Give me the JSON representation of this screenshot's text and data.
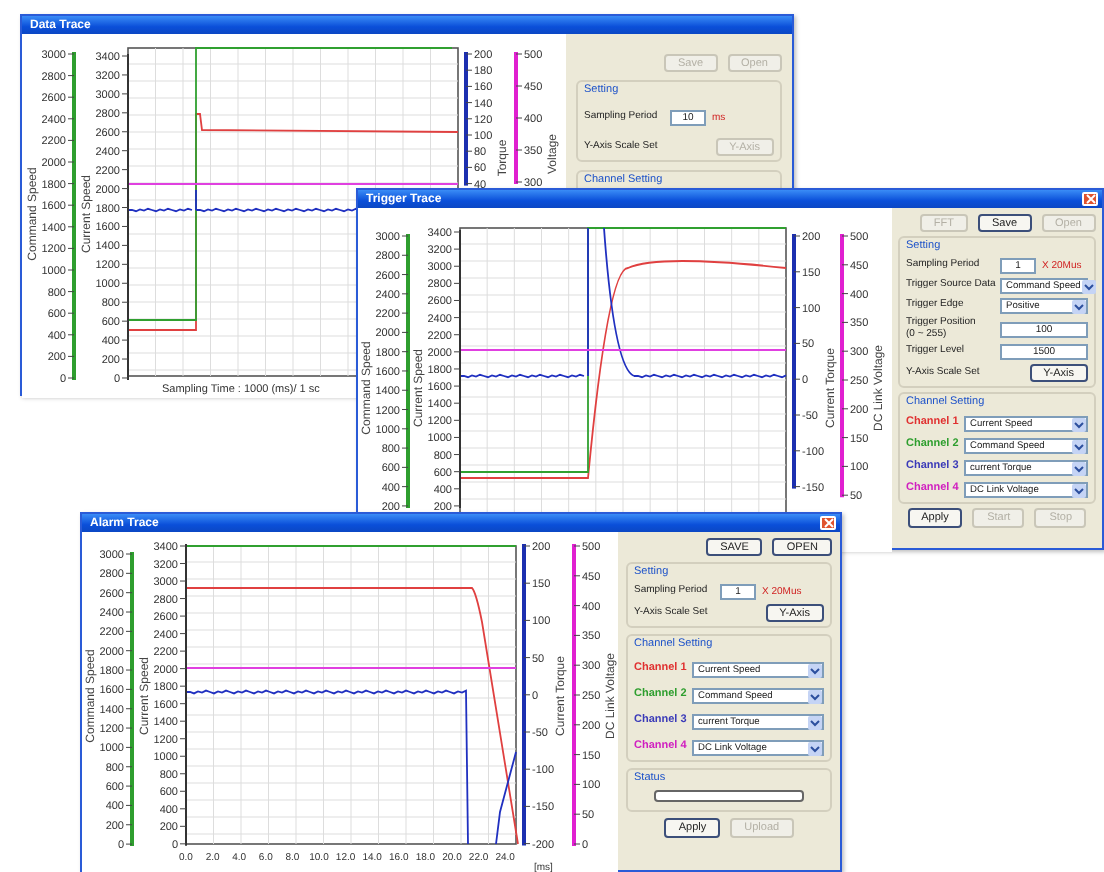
{
  "windows": [
    {
      "title": "Data Trace",
      "closable": false,
      "chart": {
        "left_axes": [
          {
            "title": "Command Speed",
            "color": "#2e9e2e",
            "ticks": [
              "3000",
              "2800",
              "2600",
              "2400",
              "2200",
              "2000",
              "1800",
              "1600",
              "1400",
              "1200",
              "1000",
              "800",
              "600",
              "400",
              "200",
              "0"
            ]
          },
          {
            "title": "Current Speed",
            "color": "#333333",
            "ticks": [
              "3400",
              "3200",
              "3000",
              "2800",
              "2600",
              "2400",
              "2200",
              "2000",
              "1800",
              "1600",
              "1400",
              "1200",
              "1000",
              "800",
              "600",
              "400",
              "200",
              "0"
            ]
          }
        ],
        "right_axes": [
          {
            "title": "Torque",
            "color": "#1c2fb0",
            "ticks": [
              "200",
              "180",
              "160",
              "140",
              "120",
              "100",
              "80",
              "60",
              "40"
            ]
          },
          {
            "title": "Voltage",
            "color": "#e020d0",
            "ticks": [
              "500",
              "450",
              "400",
              "350",
              "300"
            ]
          }
        ],
        "xlabel": "Sampling Time : 1000 (ms)/ 1 sc"
      },
      "panel": {
        "buttons": [
          {
            "label": "Save",
            "disabled": true
          },
          {
            "label": "Open",
            "disabled": true
          }
        ],
        "setting": {
          "title": "Setting",
          "rows": [
            {
              "kind": "input",
              "label": "Sampling Period",
              "value": "10",
              "unit": "ms"
            },
            {
              "kind": "button",
              "label": "Y-Axis Scale Set",
              "button": {
                "label": "Y-Axis",
                "disabled": true
              }
            }
          ]
        },
        "channel_setting": {
          "title": "Channel Setting"
        }
      }
    },
    {
      "title": "Trigger Trace",
      "closable": true,
      "chart": {
        "left_axes": [
          {
            "title": "Command Speed",
            "color": "#2e9e2e",
            "ticks": [
              "3000",
              "2800",
              "2600",
              "2400",
              "2200",
              "2000",
              "1800",
              "1600",
              "1400",
              "1200",
              "1000",
              "800",
              "600",
              "400",
              "200"
            ]
          },
          {
            "title": "Current Speed",
            "color": "#333333",
            "ticks": [
              "3400",
              "3200",
              "3000",
              "2800",
              "2600",
              "2400",
              "2200",
              "2000",
              "1800",
              "1600",
              "1400",
              "1200",
              "1000",
              "800",
              "600",
              "400",
              "200"
            ]
          }
        ],
        "right_axes": [
          {
            "title": "Current Torque",
            "color": "#1c2fb0",
            "ticks": [
              "200",
              "150",
              "100",
              "50",
              "0",
              "-50",
              "-100",
              "-150"
            ]
          },
          {
            "title": "DC Link Voltage",
            "color": "#e020d0",
            "ticks": [
              "500",
              "450",
              "400",
              "350",
              "300",
              "250",
              "200",
              "150",
              "100",
              "50"
            ]
          }
        ]
      },
      "panel": {
        "buttons": [
          {
            "label": "FFT",
            "disabled": true
          },
          {
            "label": "Save",
            "disabled": false
          },
          {
            "label": "Open",
            "disabled": true
          }
        ],
        "setting": {
          "title": "Setting",
          "rows": [
            {
              "kind": "input",
              "label": "Sampling Period",
              "value": "1",
              "unit": "X 20Mus"
            },
            {
              "kind": "select",
              "label": "Trigger Source Data",
              "value": "Command Speed"
            },
            {
              "kind": "select",
              "label": "Trigger Edge",
              "value": "Positive"
            },
            {
              "kind": "input",
              "label": "Trigger Position\n(0 ~ 255)",
              "value": "100"
            },
            {
              "kind": "input",
              "label": "Trigger Level",
              "value": "1500"
            },
            {
              "kind": "button",
              "label": "Y-Axis Scale Set",
              "button": {
                "label": "Y-Axis",
                "disabled": false
              }
            }
          ]
        },
        "channel_setting": {
          "title": "Channel Setting",
          "channels": [
            {
              "label": "Channel 1",
              "color": "#e03030",
              "value": "Current Speed"
            },
            {
              "label": "Channel 2",
              "color": "#2e9e2e",
              "value": "Command Speed"
            },
            {
              "label": "Channel 3",
              "color": "#3a3ab8",
              "value": "current Torque"
            },
            {
              "label": "Channel 4",
              "color": "#d020c0",
              "value": "DC Link Voltage"
            }
          ]
        },
        "bottom_buttons": [
          {
            "label": "Apply",
            "disabled": false
          },
          {
            "label": "Start",
            "disabled": true
          },
          {
            "label": "Stop",
            "disabled": true
          }
        ]
      }
    },
    {
      "title": "Alarm Trace",
      "closable": true,
      "chart": {
        "left_axes": [
          {
            "title": "Command Speed",
            "color": "#2e9e2e",
            "ticks": [
              "3000",
              "2800",
              "2600",
              "2400",
              "2200",
              "2000",
              "1800",
              "1600",
              "1400",
              "1200",
              "1000",
              "800",
              "600",
              "400",
              "200",
              "0"
            ]
          },
          {
            "title": "Current Speed",
            "color": "#333333",
            "ticks": [
              "3400",
              "3200",
              "3000",
              "2800",
              "2600",
              "2400",
              "2200",
              "2000",
              "1800",
              "1600",
              "1400",
              "1200",
              "1000",
              "800",
              "600",
              "400",
              "200",
              "0"
            ]
          }
        ],
        "right_axes": [
          {
            "title": "Current Torque",
            "color": "#1c2fb0",
            "ticks": [
              "200",
              "150",
              "100",
              "50",
              "0",
              "-50",
              "-100",
              "-150",
              "-200"
            ]
          },
          {
            "title": "DC Link Voltage",
            "color": "#e020d0",
            "ticks": [
              "500",
              "450",
              "400",
              "350",
              "300",
              "250",
              "200",
              "150",
              "100",
              "50",
              "0"
            ]
          }
        ],
        "x_ticks": [
          "0.0",
          "2.0",
          "4.0",
          "6.0",
          "8.0",
          "10.0",
          "12.0",
          "14.0",
          "16.0",
          "18.0",
          "20.0",
          "22.0",
          "24.0"
        ],
        "x_unit": "[ms]"
      },
      "panel": {
        "buttons": [
          {
            "label": "SAVE",
            "disabled": false
          },
          {
            "label": "OPEN",
            "disabled": false
          }
        ],
        "setting": {
          "title": "Setting",
          "rows": [
            {
              "kind": "input",
              "label": "Sampling Period",
              "value": "1",
              "unit": "X 20Mus"
            },
            {
              "kind": "button",
              "label": "Y-Axis Scale Set",
              "button": {
                "label": "Y-Axis",
                "disabled": false
              }
            }
          ]
        },
        "channel_setting": {
          "title": "Channel Setting",
          "channels": [
            {
              "label": "Channel 1",
              "color": "#e03030",
              "value": "Current Speed"
            },
            {
              "label": "Channel 2",
              "color": "#2e9e2e",
              "value": "Command Speed"
            },
            {
              "label": "Channel 3",
              "color": "#3a3ab8",
              "value": "current Torque"
            },
            {
              "label": "Channel 4",
              "color": "#d020c0",
              "value": "DC Link Voltage"
            }
          ]
        },
        "status": {
          "title": "Status",
          "level": 0
        },
        "bottom_buttons": [
          {
            "label": "Apply",
            "disabled": false
          },
          {
            "label": "Upload",
            "disabled": true
          }
        ]
      }
    }
  ]
}
